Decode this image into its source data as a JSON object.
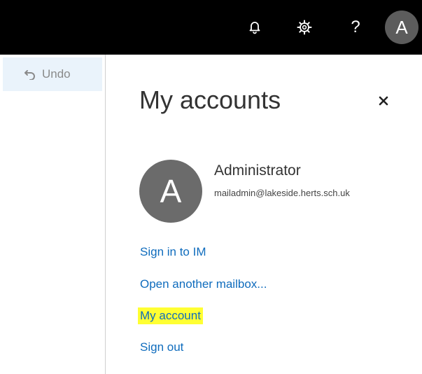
{
  "topbar": {
    "icons": [
      "bell-icon",
      "gear-icon",
      "help-icon"
    ],
    "help_glyph": "?",
    "avatar_initial": "A"
  },
  "toolbar": {
    "undo_label": "Undo",
    "undo_icon": "undo-arrow-icon"
  },
  "panel": {
    "title": "My accounts",
    "close_glyph": "×",
    "account": {
      "initial": "A",
      "name": "Administrator",
      "email": "mailadmin@lakeside.herts.sch.uk"
    },
    "links": [
      {
        "label": "Sign in to IM",
        "highlighted": false
      },
      {
        "label": "Open another mailbox...",
        "highlighted": false
      },
      {
        "label": "My account",
        "highlighted": true
      },
      {
        "label": "Sign out",
        "highlighted": false
      }
    ]
  },
  "colors": {
    "topbar_bg": "#000000",
    "avatar_bg": "#5c5c5c",
    "link": "#0f6cbd",
    "highlight": "#ffff33",
    "undo_bg": "#eaf3fb"
  }
}
